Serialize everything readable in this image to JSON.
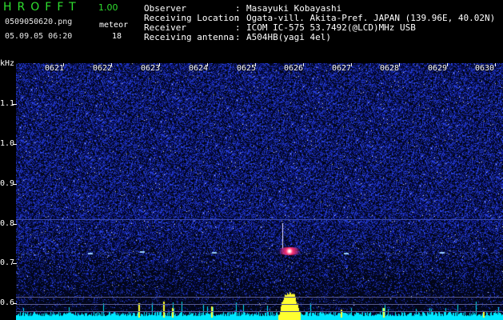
{
  "app": {
    "title": "HROFFT",
    "version": "1.00",
    "filename": "0509050620.png",
    "datetime": "05.09.05 06:20",
    "meteor_label": "meteor",
    "meteor_count": "18"
  },
  "station": {
    "rows": [
      {
        "label": "Observer",
        "value": "Masayuki Kobayashi"
      },
      {
        "label": "Receiving Location",
        "value": "Ogata-vill. Akita-Pref. JAPAN (139.96E, 40.02N)"
      },
      {
        "label": "Receiver",
        "value": "ICOM IC-575 53.7492(@LCD)MHz USB"
      },
      {
        "label": "Receiving antenna",
        "value": "A504HB(yagi 4el)"
      }
    ],
    "separator": ":"
  },
  "time_axis": {
    "ticks": [
      "0621",
      "0622",
      "0623",
      "0624",
      "0625",
      "0626",
      "0627",
      "0628",
      "0629",
      "0630"
    ]
  },
  "freq_axis": {
    "unit": "kHz",
    "labels": [
      "1.1",
      "1.0",
      "0.9",
      "0.8",
      "0.7",
      "0.6"
    ]
  },
  "colors": {
    "title_green": "#2fe02f",
    "background_noise": "#1a2ab0",
    "spectrum_line": "#00ffff",
    "spectrum_peak": "#ffff00",
    "echo_core": "#ff2a6a",
    "reference_line": "#404aa0"
  }
}
